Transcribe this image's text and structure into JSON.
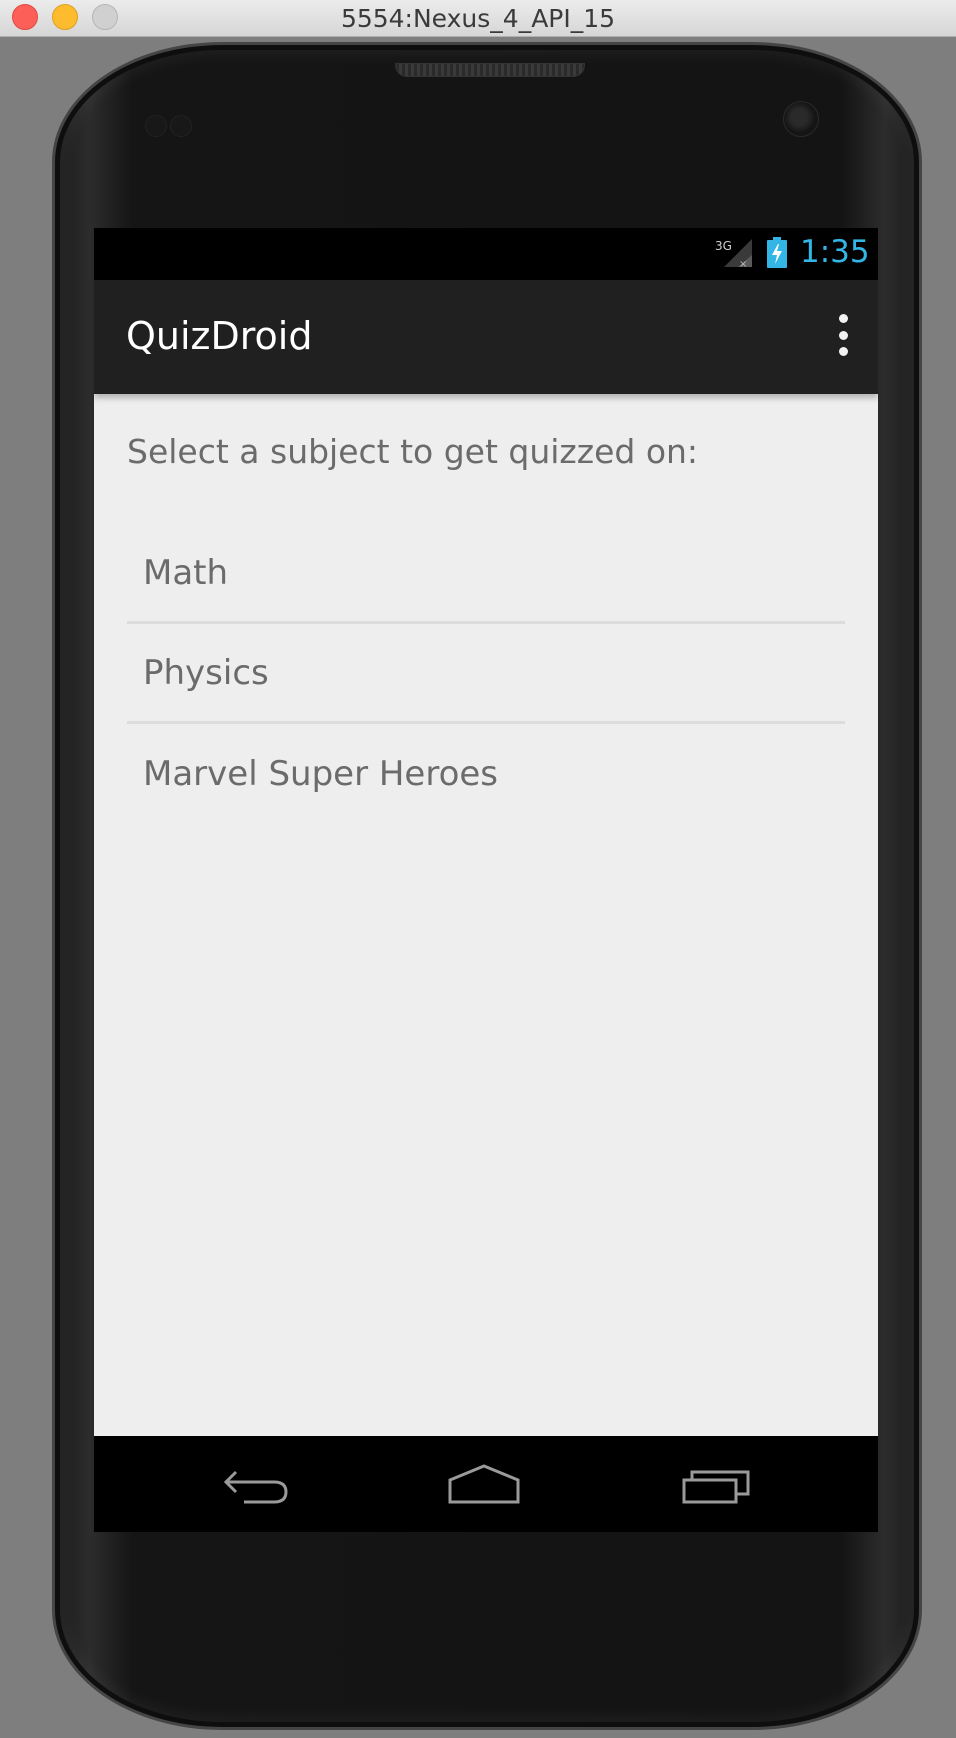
{
  "window": {
    "title": "5554:Nexus_4_API_15"
  },
  "status_bar": {
    "network_label": "3G",
    "time": "1:35",
    "clock_color": "#33b5e5"
  },
  "action_bar": {
    "title": "QuizDroid",
    "overflow_icon": "overflow-menu-icon"
  },
  "main": {
    "prompt": "Select a subject to get quizzed on:",
    "subjects": [
      {
        "label": "Math"
      },
      {
        "label": "Physics"
      },
      {
        "label": "Marvel Super Heroes"
      }
    ]
  },
  "nav_bar": {
    "buttons": [
      {
        "icon": "back-icon"
      },
      {
        "icon": "home-icon"
      },
      {
        "icon": "recent-apps-icon"
      }
    ]
  }
}
